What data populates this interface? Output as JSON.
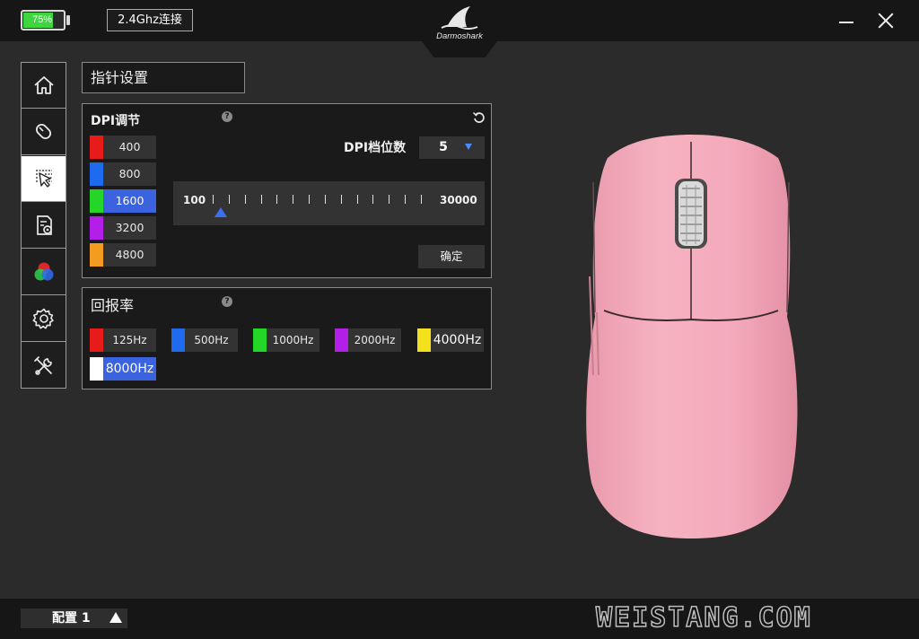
{
  "header": {
    "battery_text": "75%",
    "battery_level": 0.75,
    "connection_label": "2.4Ghz连接",
    "brand": "Darmoshark"
  },
  "sidebar": {
    "items": [
      {
        "icon": "home-icon",
        "active": false
      },
      {
        "icon": "mouse-icon",
        "active": false
      },
      {
        "icon": "pointer-settings-icon",
        "active": true
      },
      {
        "icon": "macro-document-icon",
        "active": false
      },
      {
        "icon": "rgb-lighting-icon",
        "active": false
      },
      {
        "icon": "gear-icon",
        "active": false
      },
      {
        "icon": "tools-icon",
        "active": false
      }
    ]
  },
  "panel_title": "指针设置",
  "dpi": {
    "title": "DPI调节",
    "help": "?",
    "levels": [
      {
        "value": "400",
        "color": "#e81b1b",
        "selected": false
      },
      {
        "value": "800",
        "color": "#1e6bf0",
        "selected": false
      },
      {
        "value": "1600",
        "color": "#24d628",
        "selected": true
      },
      {
        "value": "3200",
        "color": "#b31ee8",
        "selected": false
      },
      {
        "value": "4800",
        "color": "#f39c1f",
        "selected": false
      }
    ],
    "count_label": "DPI档位数",
    "count_value": "5",
    "slider_min": "100",
    "slider_max": "30000",
    "slider_value": 1600,
    "confirm_label": "确定"
  },
  "report_rate": {
    "title": "回报率",
    "help": "?",
    "options": [
      {
        "value": "125Hz",
        "color": "#e81b1b",
        "selected": false
      },
      {
        "value": "500Hz",
        "color": "#1e6bf0",
        "selected": false
      },
      {
        "value": "1000Hz",
        "color": "#24d628",
        "selected": false
      },
      {
        "value": "2000Hz",
        "color": "#b31ee8",
        "selected": false
      },
      {
        "value": "4000Hz",
        "color": "#f5e11b",
        "selected": false
      },
      {
        "value": "8000Hz",
        "color": "#ffffff",
        "selected": true
      }
    ]
  },
  "footer": {
    "profile_label": "配置 1",
    "watermark": "WEISTANG.COM"
  },
  "colors": {
    "accent": "#3b63e0",
    "mouse_body": "#f4a9b8"
  }
}
